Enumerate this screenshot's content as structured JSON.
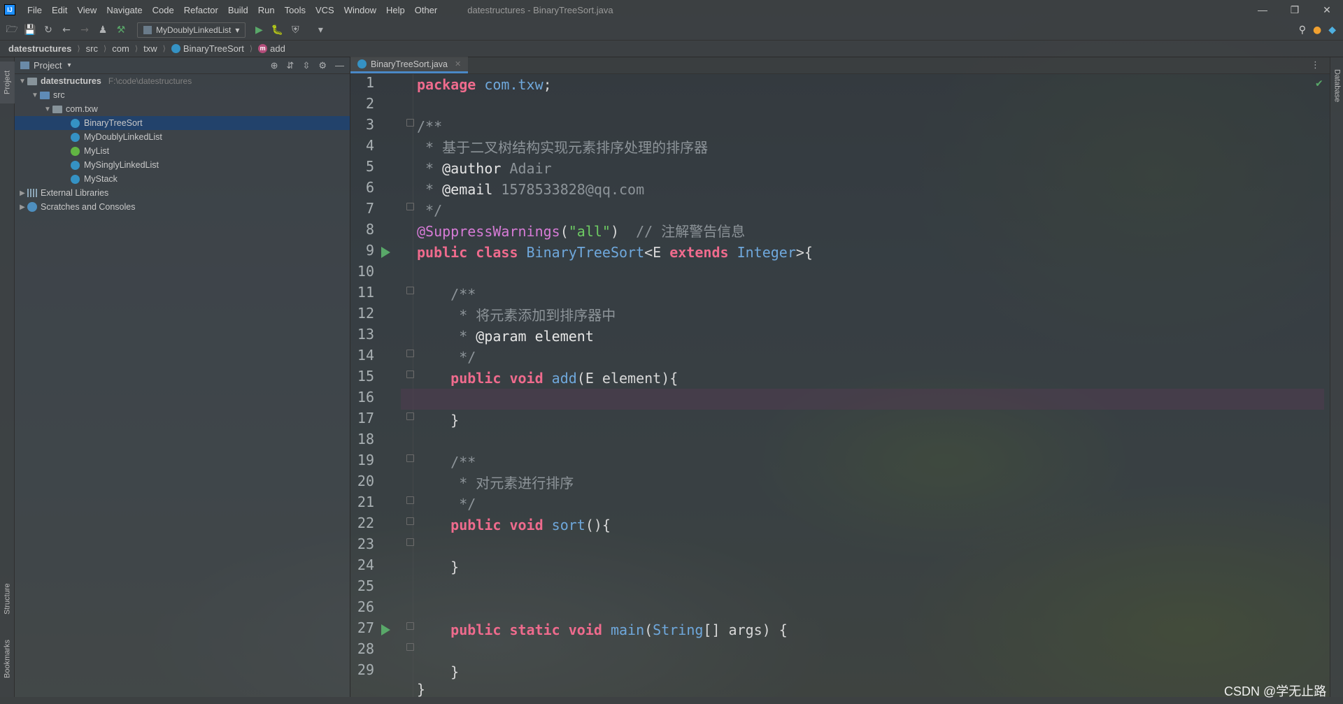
{
  "menubar": {
    "logo": "IJ",
    "items": [
      "File",
      "Edit",
      "View",
      "Navigate",
      "Code",
      "Refactor",
      "Build",
      "Run",
      "Tools",
      "VCS",
      "Window",
      "Help",
      "Other"
    ],
    "window_title": "datestructures - BinaryTreeSort.java"
  },
  "toolbar": {
    "run_config": "MyDoublyLinkedList"
  },
  "breadcrumbs": {
    "items": [
      "datestructures",
      "src",
      "com",
      "txw",
      "BinaryTreeSort",
      "add"
    ]
  },
  "left_stripe": {
    "project": "Project",
    "structure": "Structure",
    "bookmarks": "Bookmarks"
  },
  "right_stripe": {
    "database": "Database"
  },
  "project_panel": {
    "title": "Project",
    "tree": {
      "root": {
        "label": "datestructures",
        "path": "F:\\code\\datestructures"
      },
      "src": "src",
      "package": "com.txw",
      "files": [
        "BinaryTreeSort",
        "MyDoublyLinkedList",
        "MyList",
        "MySinglyLinkedList",
        "MyStack"
      ],
      "external_libraries": "External Libraries",
      "scratches": "Scratches and Consoles"
    }
  },
  "editor": {
    "tab": "BinaryTreeSort.java",
    "line_numbers": [
      "1",
      "2",
      "3",
      "4",
      "5",
      "6",
      "7",
      "8",
      "9",
      "10",
      "11",
      "12",
      "13",
      "14",
      "15",
      "16",
      "17",
      "18",
      "19",
      "20",
      "21",
      "22",
      "23",
      "24",
      "25",
      "26",
      "27",
      "28",
      "29"
    ],
    "code": {
      "l1_kw": "package",
      "l1_pkg": " com.txw",
      "l1_end": ";",
      "l3": "/**",
      "l4": " * 基于二叉树结构实现元素排序处理的排序器",
      "l5_star": " * ",
      "l5_tag": "@author",
      "l5_val": " Adair",
      "l6_star": " * ",
      "l6_tag": "@email",
      "l6_val": " 1578533828@qq.com",
      "l7": " */",
      "l8_ann": "@SuppressWarnings",
      "l8_open": "(",
      "l8_str": "\"all\"",
      "l8_close": ")",
      "l8_cmt": "  // 注解警告信息",
      "l9_kw": "public class",
      "l9_name": " BinaryTreeSort",
      "l9_gen": "<E ",
      "l9_kw2": "extends",
      "l9_type": " Integer",
      "l9_end": ">{",
      "l11": "    /**",
      "l12": "     * 将元素添加到排序器中",
      "l13_star": "     * ",
      "l13_tag": "@param",
      "l13_val": " element",
      "l14": "     */",
      "l15_kw": "    public void",
      "l15_fn": " add",
      "l15_rest": "(E element){",
      "l17": "    }",
      "l19": "    /**",
      "l20": "     * 对元素进行排序",
      "l21": "     */",
      "l22_kw": "    public void",
      "l22_fn": " sort",
      "l22_rest": "(){",
      "l24": "    }",
      "l26_kw": "    public static void",
      "l26_fn": " main",
      "l26_open": "(",
      "l26_type": "String",
      "l26_rest": "[] args) {",
      "l28": "    }",
      "l29": "}"
    }
  },
  "watermark": "CSDN @学无止路",
  "colors": {
    "keyword": "#ef6b8d",
    "type": "#6fa8dc",
    "comment": "#8d9499",
    "annotation": "#d67bd6",
    "string": "#6ecb63",
    "selection": "#21426e",
    "run_marker": "#59a869"
  }
}
